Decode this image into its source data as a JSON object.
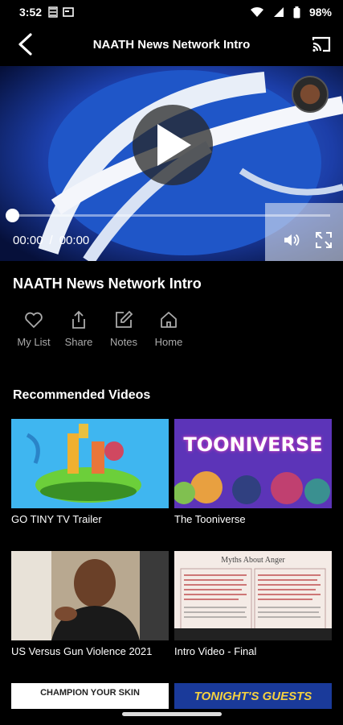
{
  "status_bar": {
    "time": "3:52",
    "battery": "98%"
  },
  "header": {
    "title": "NAATH News Network Intro"
  },
  "player": {
    "current_time": "00:00",
    "separator": "/",
    "duration": "00:00",
    "progress": 0
  },
  "video": {
    "title": "NAATH News Network Intro"
  },
  "actions": [
    {
      "label": "My List",
      "icon": "heart-icon"
    },
    {
      "label": "Share",
      "icon": "share-icon"
    },
    {
      "label": "Notes",
      "icon": "edit-icon"
    },
    {
      "label": "Home",
      "icon": "home-icon"
    }
  ],
  "recommended": {
    "title": "Recommended Videos",
    "items": [
      {
        "title": "GO TINY TV Trailer"
      },
      {
        "title": "The Tooniverse",
        "thumb_text": "TOONIVERSE"
      },
      {
        "title": "US Versus Gun Violence 2021"
      },
      {
        "title": "Intro Video - Final",
        "thumb_text": "Myths About Anger"
      },
      {
        "title": "",
        "thumb_text": "CHAMPION YOUR SKIN"
      },
      {
        "title": "",
        "thumb_text": "TONIGHT'S GUESTS"
      }
    ]
  }
}
